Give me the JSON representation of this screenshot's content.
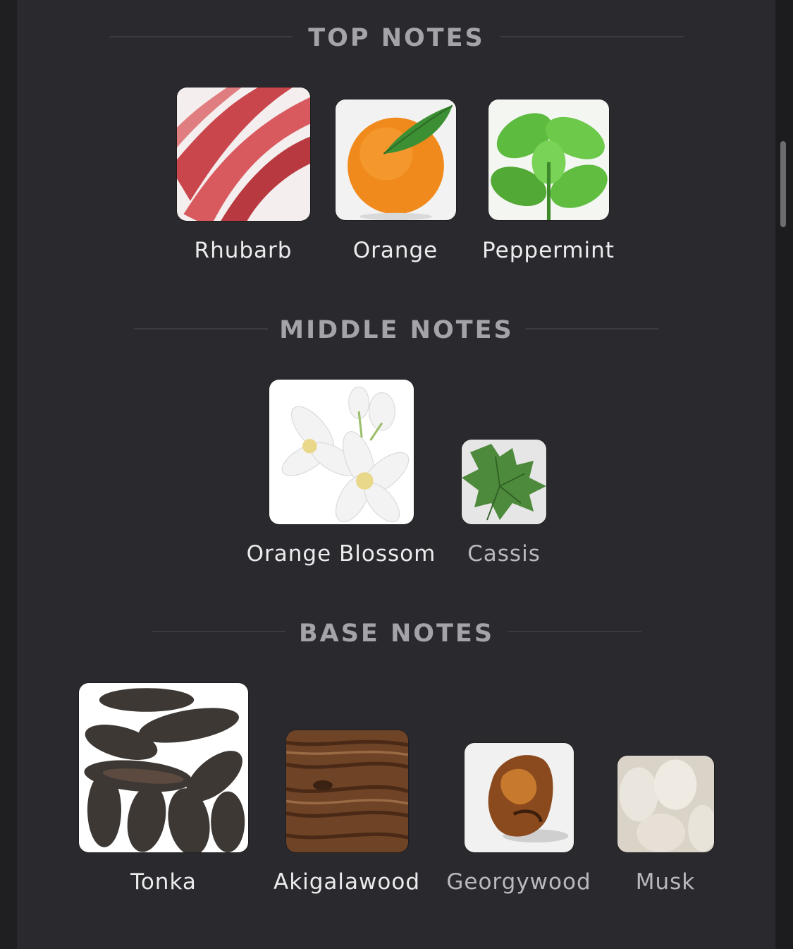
{
  "sections": {
    "top": {
      "title": "TOP NOTES",
      "notes": [
        {
          "label": "Rhubarb",
          "icon": "rhubarb-image"
        },
        {
          "label": "Orange",
          "icon": "orange-image"
        },
        {
          "label": "Peppermint",
          "icon": "peppermint-image"
        }
      ]
    },
    "middle": {
      "title": "MIDDLE NOTES",
      "notes": [
        {
          "label": "Orange Blossom",
          "icon": "orange-blossom-image"
        },
        {
          "label": "Cassis",
          "icon": "cassis-image"
        }
      ]
    },
    "base": {
      "title": "BASE NOTES",
      "notes": [
        {
          "label": "Tonka",
          "icon": "tonka-image"
        },
        {
          "label": "Akigalawood",
          "icon": "akigalawood-image"
        },
        {
          "label": "Georgywood",
          "icon": "georgywood-image"
        },
        {
          "label": "Musk",
          "icon": "musk-image"
        }
      ]
    }
  },
  "colors": {
    "background": "#2a2a2e",
    "heading": "#a3a3a8",
    "label": "#ececee"
  }
}
